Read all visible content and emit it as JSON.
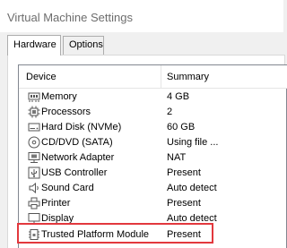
{
  "window": {
    "title": "Virtual Machine Settings"
  },
  "tabs": [
    {
      "label": "Hardware",
      "active": true
    },
    {
      "label": "Options",
      "active": false
    }
  ],
  "device_list": {
    "columns": {
      "device": "Device",
      "summary": "Summary"
    },
    "rows": [
      {
        "device": "Memory",
        "summary": "4 GB",
        "icon": "memory-icon"
      },
      {
        "device": "Processors",
        "summary": "2",
        "icon": "processor-icon"
      },
      {
        "device": "Hard Disk (NVMe)",
        "summary": "60 GB",
        "icon": "hard-disk-icon"
      },
      {
        "device": "CD/DVD (SATA)",
        "summary": "Using file ...",
        "icon": "cd-dvd-icon"
      },
      {
        "device": "Network Adapter",
        "summary": "NAT",
        "icon": "network-adapter-icon"
      },
      {
        "device": "USB Controller",
        "summary": "Present",
        "icon": "usb-controller-icon"
      },
      {
        "device": "Sound Card",
        "summary": "Auto detect",
        "icon": "sound-card-icon"
      },
      {
        "device": "Printer",
        "summary": "Present",
        "icon": "printer-icon"
      },
      {
        "device": "Display",
        "summary": "Auto detect",
        "icon": "display-icon"
      },
      {
        "device": "Trusted Platform Module",
        "summary": "Present",
        "icon": "tpm-chip-icon",
        "highlighted": true
      }
    ]
  },
  "colors": {
    "highlight_border": "#e2383d",
    "title_text": "#6d6d6d"
  }
}
